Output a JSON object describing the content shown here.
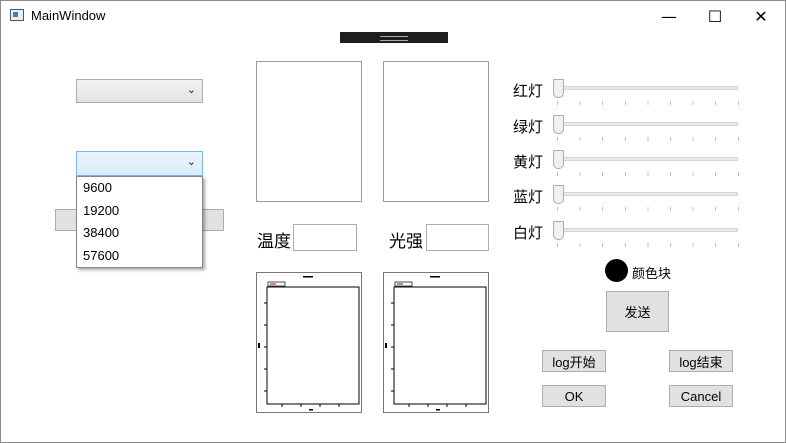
{
  "window": {
    "title": "MainWindow",
    "minimize": "—",
    "maximize": "☐",
    "close": "✕"
  },
  "ports": {
    "port_combo_value": "",
    "baud_combo_value": "",
    "baud_options": [
      "9600",
      "19200",
      "38400",
      "57600"
    ]
  },
  "sensors": {
    "temperature_label": "温度",
    "temperature_value": "",
    "light_label": "光强",
    "light_value": ""
  },
  "lights": {
    "red": {
      "label": "红灯",
      "value": 0
    },
    "green": {
      "label": "绿灯",
      "value": 0
    },
    "yellow": {
      "label": "黄灯",
      "value": 0
    },
    "blue": {
      "label": "蓝灯",
      "value": 0
    },
    "white": {
      "label": "白灯",
      "value": 0
    }
  },
  "color_block": {
    "label": "颜色块",
    "color": "#000000"
  },
  "buttons": {
    "send": "发送",
    "log_start": "log开始",
    "log_end": "log结束",
    "ok": "OK",
    "cancel": "Cancel"
  },
  "icons": {
    "combo_chevron": "chevron-down-icon",
    "app": "window-app-icon"
  }
}
